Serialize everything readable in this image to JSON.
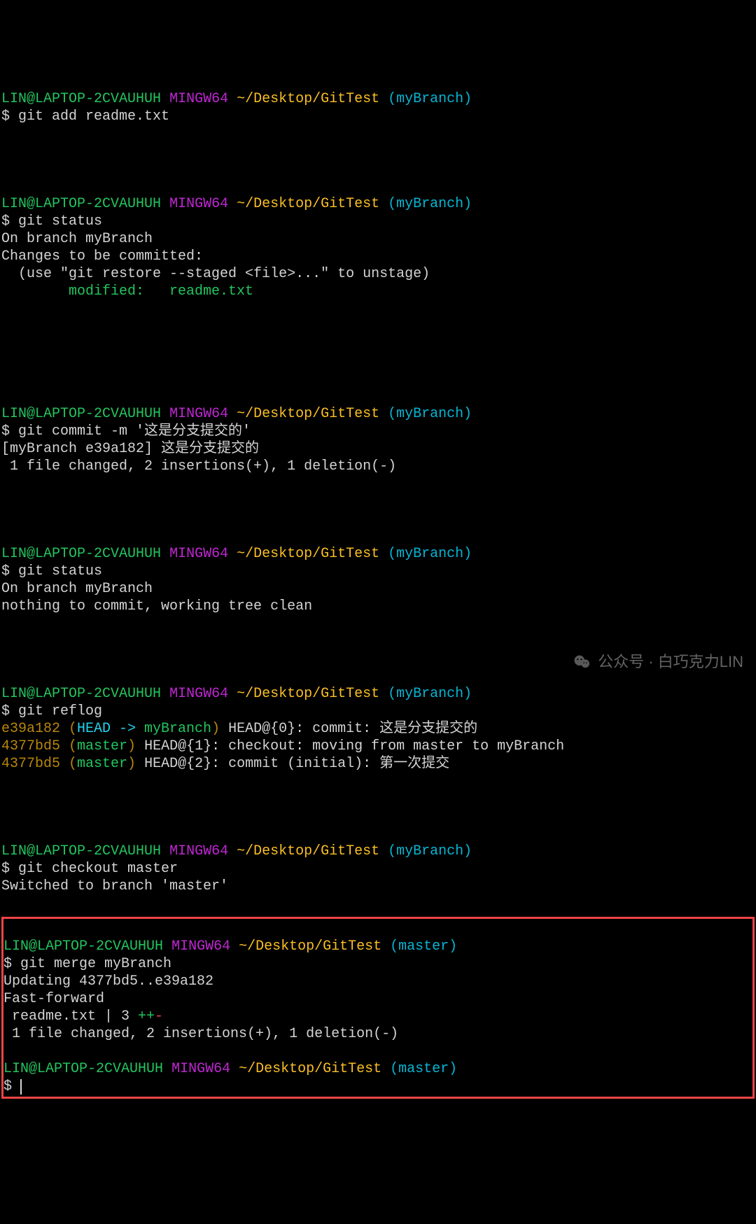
{
  "prompts": [
    {
      "user": "LIN@LAPTOP-2CVAUHUH",
      "env": "MINGW64",
      "path": "~/Desktop/GitTest",
      "branch": "(myBranch)",
      "cmd": "git add readme.txt"
    },
    {
      "user": "LIN@LAPTOP-2CVAUHUH",
      "env": "MINGW64",
      "path": "~/Desktop/GitTest",
      "branch": "(myBranch)",
      "cmd": "git status"
    },
    {
      "user": "LIN@LAPTOP-2CVAUHUH",
      "env": "MINGW64",
      "path": "~/Desktop/GitTest",
      "branch": "(myBranch)",
      "cmd": "git commit -m '这是分支提交的'"
    },
    {
      "user": "LIN@LAPTOP-2CVAUHUH",
      "env": "MINGW64",
      "path": "~/Desktop/GitTest",
      "branch": "(myBranch)",
      "cmd": "git status"
    },
    {
      "user": "LIN@LAPTOP-2CVAUHUH",
      "env": "MINGW64",
      "path": "~/Desktop/GitTest",
      "branch": "(myBranch)",
      "cmd": "git reflog"
    },
    {
      "user": "LIN@LAPTOP-2CVAUHUH",
      "env": "MINGW64",
      "path": "~/Desktop/GitTest",
      "branch": "(myBranch)",
      "cmd": "git checkout master"
    },
    {
      "user": "LIN@LAPTOP-2CVAUHUH",
      "env": "MINGW64",
      "path": "~/Desktop/GitTest",
      "branch": "(master)",
      "cmd": "git merge myBranch"
    },
    {
      "user": "LIN@LAPTOP-2CVAUHUH",
      "env": "MINGW64",
      "path": "~/Desktop/GitTest",
      "branch": "(master)",
      "cmd": ""
    }
  ],
  "status1": {
    "on": "On branch myBranch",
    "changes": "Changes to be committed:",
    "hint": "  (use \"git restore --staged <file>...\" to unstage)",
    "mod": "        modified:   readme.txt"
  },
  "commit": {
    "line1_pre": "[myBranch e39a182] ",
    "line1_msg": "这是分支提交的",
    "line2": " 1 file changed, 2 insertions(+), 1 deletion(-)"
  },
  "status2": {
    "on": "On branch myBranch",
    "clean": "nothing to commit, working tree clean"
  },
  "reflog": {
    "l0": {
      "hash": "e39a182",
      "open": " (",
      "head": "HEAD -> ",
      "ref": "myBranch",
      "close": ") ",
      "rest": "HEAD@{0}: commit: 这是分支提交的"
    },
    "l1": {
      "hash": "4377bd5",
      "open": " (",
      "ref": "master",
      "close": ") ",
      "rest": "HEAD@{1}: checkout: moving from master to myBranch"
    },
    "l2": {
      "hash": "4377bd5",
      "open": " (",
      "ref": "master",
      "close": ") ",
      "rest": "HEAD@{2}: commit (initial): 第一次提交"
    }
  },
  "checkout": {
    "msg": "Switched to branch 'master'"
  },
  "merge": {
    "l0": "Updating 4377bd5..e39a182",
    "l1": "Fast-forward",
    "l2_pre": " readme.txt | 3 ",
    "l2_plus": "++",
    "l2_minus": "-",
    "l3": " 1 file changed, 2 insertions(+), 1 deletion(-)"
  },
  "dollar": "$ ",
  "watermark": "公众号 · 白巧克力LIN"
}
